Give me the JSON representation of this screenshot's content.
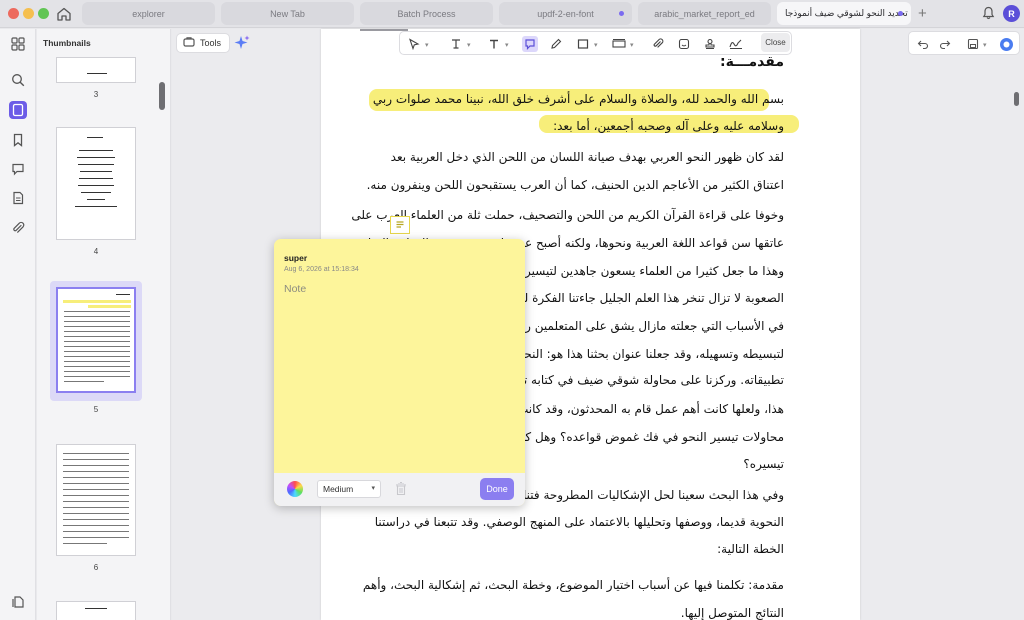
{
  "tabs": [
    {
      "label": "explorer"
    },
    {
      "label": "New Tab"
    },
    {
      "label": "Batch Process"
    },
    {
      "label": "updf-2-en-font"
    },
    {
      "label": "arabic_market_report_ed"
    },
    {
      "label": "تحديد النحو لشوقي ضيف أنموذجا"
    }
  ],
  "user": {
    "avatar_initial": "R"
  },
  "colors": {
    "accent": "#6c5ce7",
    "highlight": "#f7ee7a",
    "note_bg": "#fdf59b",
    "done": "#8b7ef0"
  },
  "icons": [
    "home-icon",
    "plus-icon",
    "bell-icon",
    "grid-icon",
    "search-icon",
    "thumbnails-icon",
    "bookmark-icon",
    "comment-icon",
    "page-icon",
    "attachment-icon",
    "layers-icon",
    "tools-icon",
    "sparkle-icon",
    "select-arrow-icon",
    "text-cursor-icon",
    "text-icon",
    "note-icon",
    "pencil-icon",
    "rectangle-icon",
    "textfield-icon",
    "paperclip-icon",
    "sticker-icon",
    "stamp-icon",
    "signature-icon",
    "undo-icon",
    "redo-icon",
    "save-icon",
    "account-icon"
  ],
  "sidebar": {
    "title": "Thumbnails",
    "pages": [
      {
        "num": "3"
      },
      {
        "num": "4"
      },
      {
        "num": "5"
      },
      {
        "num": "6"
      }
    ]
  },
  "toolbar": {
    "tools_label": "Tools",
    "close_label": "Close"
  },
  "doc": {
    "lines": [
      "مقدمـــة:",
      "بسم الله والحمد لله، والصلاة والسلام على أشرف خلق الله، نبينا محمد صلوات ربي",
      "وسلامه عليه وعلى آله وصحبه أجمعين، أما بعد:",
      "لقد كان ظهور النحو العربي بهدف صيانة اللسان من اللحن الذي دخل العربية بعد",
      "اعتناق الكثير من الأعاجم الدين الحنيف، كما أن العرب يستقبحون اللحن وينفرون منه.",
      "وخوفا على قراءة القرآن الكريم من اللحن والتصحيف، حملت ثلة من العلماء العرب على",
      "عاتقها سن قواعد اللغة العربية ونحوها، ولكنه أصبح عسيرا بعد وضع هذه القواعد الصارمة",
      "وهذا ما جعل كثيرا من العلماء يسعون جاهدين لتيسيره وتبسيطه وتقريبه إلى المتعلمين",
      "الصعوبة لا تزال تنخر هذا العلم الجليل جاءتنا الفكرة لتتبع جهود العلماء المحدثين",
      "في الأسباب التي جعلته مازال يشق على المتعلمين رغم المحاولات والجهود المبذولة",
      "لتبسيطه وتسهيله، وقد جعلنا عنوان بحثنا هذا هو: النحو التعليمي بين النظرية والتطبيق",
      "تطبيقاته. وركزنا على محاولة شوقي ضيف في كتابه تجديد النحو باعتباره نموذجا",
      "هذا، ولعلها كانت أهم عمل قام به المحدثون، وقد كانت الإشكالية التي طرحناها هي",
      "محاولات تيسير النحو في فك غموض قواعده؟ وهل كانت هذه المحاولات كافية في",
      "تيسيره؟",
      "وفي هذا البحث سعينا لحل الإشكاليات المطروحة فتناولنا فيه بعض القضايا",
      "النحوية قديما، ووصفها وتحليلها بالاعتماد على المنهج الوصفي. وقد تتبعنا في دراستنا",
      "الخطة التالية:",
      "مقدمة: تكلمنا فيها عن أسباب اختيار الموضوع، وخطة البحث، ثم إشكالية البحث، وأهم",
      "النتائج المتوصل إليها."
    ]
  },
  "note": {
    "author": "super",
    "date": "Aug 6, 2026 at 15:18:34",
    "placeholder": "Note",
    "size": "Medium",
    "done_label": "Done"
  }
}
